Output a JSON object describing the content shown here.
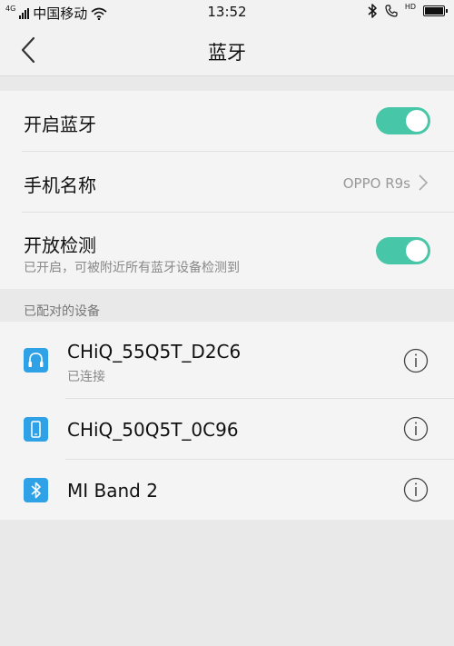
{
  "status_bar": {
    "network_type": "4G",
    "carrier": "中国移动",
    "time": "13:52",
    "hd_label": "HD",
    "battery_level": 1.0
  },
  "nav": {
    "title": "蓝牙"
  },
  "settings": {
    "bluetooth_toggle_label": "开启蓝牙",
    "bluetooth_enabled": true,
    "phone_name_label": "手机名称",
    "phone_name_value": "OPPO R9s",
    "discoverable_label": "开放检测",
    "discoverable_sub": "已开启，可被附近所有蓝牙设备检测到",
    "discoverable_enabled": true
  },
  "paired": {
    "header": "已配对的设备",
    "devices": [
      {
        "name": "CHiQ_55Q5T_D2C6",
        "status": "已连接",
        "icon": "headphones-icon"
      },
      {
        "name": "CHiQ_50Q5T_0C96",
        "status": "",
        "icon": "phone-icon"
      },
      {
        "name": "MI Band 2",
        "status": "",
        "icon": "bluetooth-icon"
      }
    ]
  },
  "colors": {
    "toggle_on": "#48c7a8",
    "device_icon_bg": "#2fa1e6"
  }
}
